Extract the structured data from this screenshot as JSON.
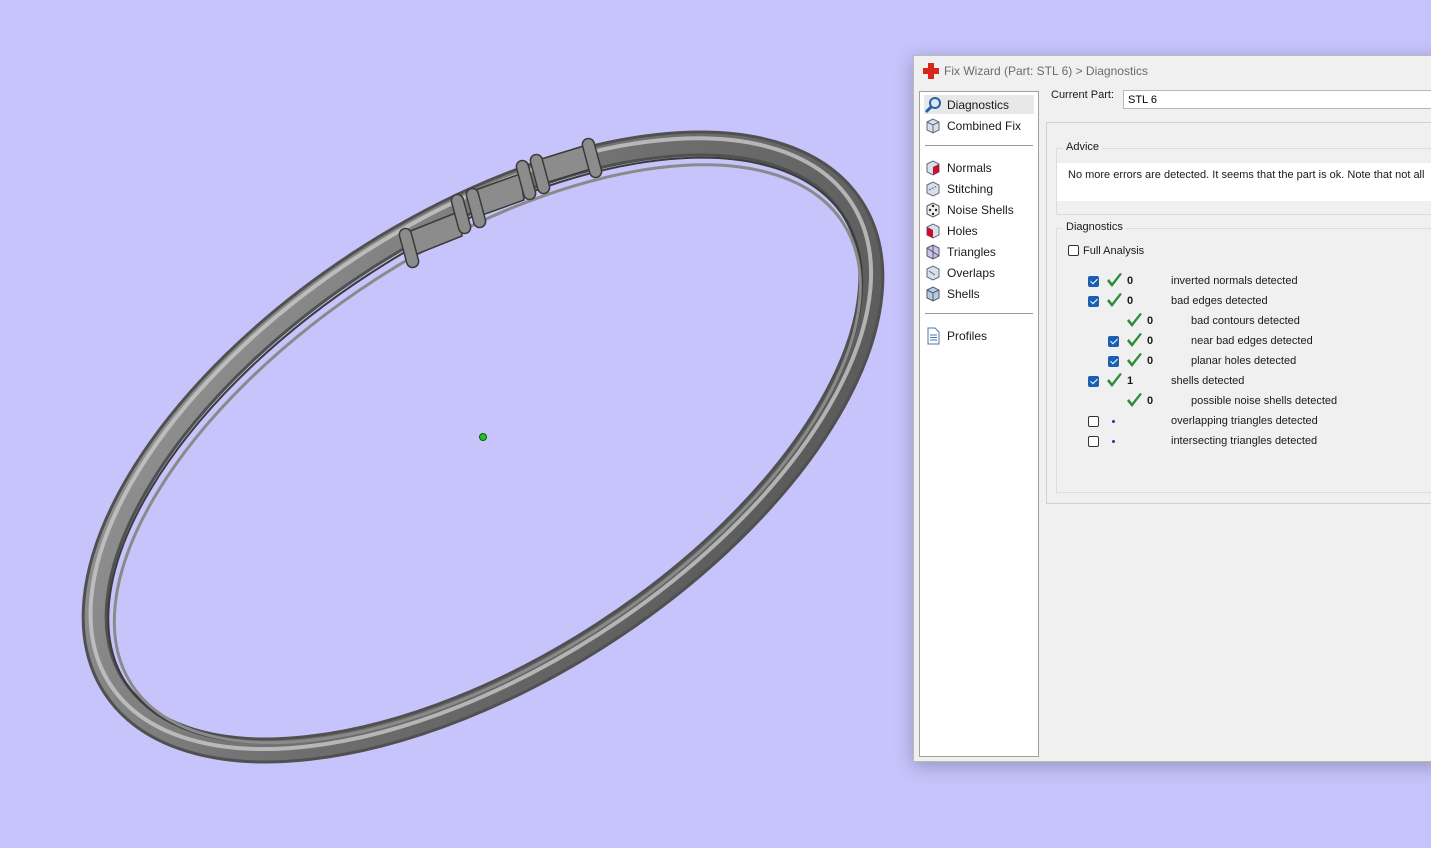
{
  "window": {
    "title": "Fix Wizard (Part: STL 6) > Diagnostics"
  },
  "nav": {
    "items": [
      {
        "label": "Diagnostics",
        "icon": "magnifier-icon",
        "selected": true
      },
      {
        "label": "Combined Fix",
        "icon": "cube-icon"
      },
      {
        "label": "Normals",
        "icon": "cube-red-face-icon"
      },
      {
        "label": "Stitching",
        "icon": "cube-stitch-icon"
      },
      {
        "label": "Noise Shells",
        "icon": "dice-icon"
      },
      {
        "label": "Holes",
        "icon": "cube-hole-icon"
      },
      {
        "label": "Triangles",
        "icon": "cube-triangle-icon"
      },
      {
        "label": "Overlaps",
        "icon": "cube-overlap-icon"
      },
      {
        "label": "Shells",
        "icon": "cube-shell-icon"
      },
      {
        "label": "Profiles",
        "icon": "document-icon"
      }
    ]
  },
  "current_part": {
    "label": "Current Part:",
    "value": "STL 6"
  },
  "advice": {
    "title": "Advice",
    "text": "No more errors are detected. It seems that the part is ok. Note that not all"
  },
  "diagnostics": {
    "title": "Diagnostics",
    "full_analysis_label": "Full Analysis",
    "full_analysis_checked": false,
    "rows": [
      {
        "checked": true,
        "status": "ok",
        "count": "0",
        "label": "inverted normals detected",
        "indent": 0
      },
      {
        "checked": true,
        "status": "ok",
        "count": "0",
        "label": "bad edges detected",
        "indent": 0
      },
      {
        "checked": null,
        "status": "ok",
        "count": "0",
        "label": "bad contours detected",
        "indent": 1
      },
      {
        "checked": true,
        "status": "ok",
        "count": "0",
        "label": "near bad edges detected",
        "indent": 1
      },
      {
        "checked": true,
        "status": "ok",
        "count": "0",
        "label": "planar holes detected",
        "indent": 1
      },
      {
        "checked": true,
        "status": "ok",
        "count": "1",
        "label": "shells detected",
        "indent": 0
      },
      {
        "checked": null,
        "status": "ok",
        "count": "0",
        "label": "possible noise shells detected",
        "indent": 1
      },
      {
        "checked": false,
        "status": "none",
        "count": "",
        "label": "overlapping triangles detected",
        "indent": 0
      },
      {
        "checked": false,
        "status": "none",
        "count": "",
        "label": "intersecting triangles detected",
        "indent": 0
      }
    ]
  },
  "colors": {
    "background": "#c6c4fb",
    "check_green": "#2e8b3a",
    "checkbox_blue": "#1a5fb4",
    "origin_marker": "#22c422"
  }
}
